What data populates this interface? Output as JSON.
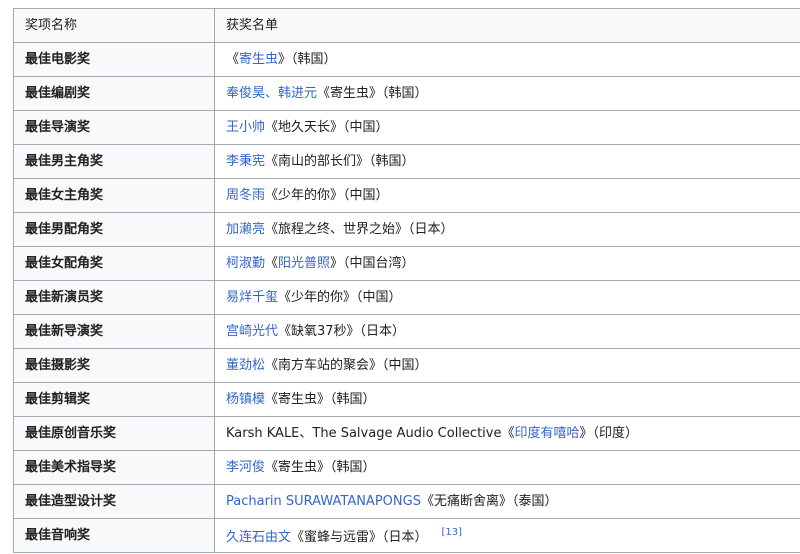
{
  "table": {
    "header": {
      "award": "奖项名称",
      "winners": "获奖名单"
    },
    "rows": [
      {
        "award": "最佳电影奖",
        "parts": [
          {
            "t": "《",
            "link": false
          },
          {
            "t": "寄生虫",
            "link": true
          },
          {
            "t": "》（韩国）",
            "link": false
          }
        ]
      },
      {
        "award": "最佳编剧奖",
        "parts": [
          {
            "t": "奉俊昊、韩进元",
            "link": true
          },
          {
            "t": "《寄生虫》（韩国）",
            "link": false
          }
        ]
      },
      {
        "award": "最佳导演奖",
        "parts": [
          {
            "t": "王小帅",
            "link": true
          },
          {
            "t": "《地久天长》（中国）",
            "link": false
          }
        ]
      },
      {
        "award": "最佳男主角奖",
        "parts": [
          {
            "t": "李秉宪",
            "link": true
          },
          {
            "t": "《南山的部长们》（韩国）",
            "link": false
          }
        ]
      },
      {
        "award": "最佳女主角奖",
        "parts": [
          {
            "t": "周冬雨",
            "link": true
          },
          {
            "t": "《少年的你》（中国）",
            "link": false
          }
        ]
      },
      {
        "award": "最佳男配角奖",
        "parts": [
          {
            "t": "加濑亮",
            "link": true
          },
          {
            "t": "《旅程之终、世界之始》（日本）",
            "link": false
          }
        ]
      },
      {
        "award": "最佳女配角奖",
        "parts": [
          {
            "t": "柯淑勤",
            "link": true
          },
          {
            "t": "《",
            "link": false
          },
          {
            "t": "阳光普照",
            "link": true
          },
          {
            "t": "》（中国台湾）",
            "link": false
          }
        ]
      },
      {
        "award": "最佳新演员奖",
        "parts": [
          {
            "t": "易烊千玺",
            "link": true
          },
          {
            "t": "《少年的你》（中国）",
            "link": false
          }
        ]
      },
      {
        "award": "最佳新导演奖",
        "parts": [
          {
            "t": "宫崎光代",
            "link": true
          },
          {
            "t": "《缺氧37秒》（日本）",
            "link": false
          }
        ]
      },
      {
        "award": "最佳摄影奖",
        "parts": [
          {
            "t": "董劲松",
            "link": true
          },
          {
            "t": "《南方车站的聚会》（中国）",
            "link": false
          }
        ]
      },
      {
        "award": "最佳剪辑奖",
        "parts": [
          {
            "t": "杨镇模",
            "link": true
          },
          {
            "t": "《寄生虫》（韩国）",
            "link": false
          }
        ]
      },
      {
        "award": "最佳原创音乐奖",
        "parts": [
          {
            "t": "Karsh KALE、The Salvage Audio Collective《",
            "link": false
          },
          {
            "t": "印度有嘻哈",
            "link": true
          },
          {
            "t": "》（印度）",
            "link": false
          }
        ]
      },
      {
        "award": "最佳美术指导奖",
        "parts": [
          {
            "t": "李河俊",
            "link": true
          },
          {
            "t": "《寄生虫》（韩国）",
            "link": false
          }
        ]
      },
      {
        "award": "最佳造型设计奖",
        "parts": [
          {
            "t": "Pacharin SURAWATANAPONGS",
            "link": true
          },
          {
            "t": "《无痛断舍离》（泰国）",
            "link": false
          }
        ]
      },
      {
        "award": "最佳音响奖",
        "parts": [
          {
            "t": "久连石由文",
            "link": true
          },
          {
            "t": "《蜜蜂与远雷》（日本）",
            "link": false
          }
        ],
        "ref": "[13]"
      }
    ]
  }
}
